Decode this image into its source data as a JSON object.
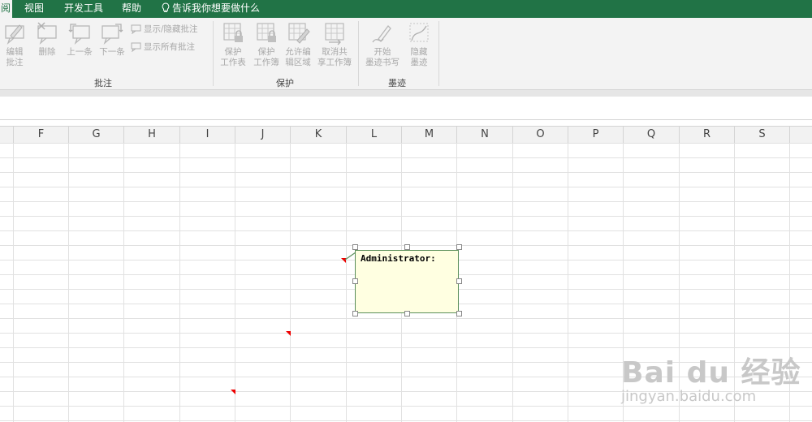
{
  "tabs": {
    "partial": "阅",
    "view": "视图",
    "developer": "开发工具",
    "help": "帮助",
    "tell_me": "告诉我你想要做什么"
  },
  "ribbon": {
    "comments_group": {
      "label": "批注",
      "edit": "编辑\n批注",
      "delete": "删除",
      "previous": "上一条",
      "next": "下一条",
      "show_hide": "显示/隐藏批注",
      "show_all": "显示所有批注"
    },
    "protect_group": {
      "label": "保护",
      "protect_sheet": "保护\n工作表",
      "protect_workbook": "保护\n工作簿",
      "allow_edit": "允许编\n辑区域",
      "unshare": "取消共\n享工作簿"
    },
    "ink_group": {
      "label": "墨迹",
      "start_ink": "开始\n墨迹书写",
      "hide_ink": "隐藏\n墨迹"
    }
  },
  "columns": [
    "F",
    "G",
    "H",
    "I",
    "J",
    "K",
    "L",
    "M",
    "N",
    "O",
    "P",
    "Q",
    "R",
    "S"
  ],
  "comment": {
    "author": "Administrator:"
  },
  "watermark": {
    "brand": "Bai du 经验",
    "url": "jingyan.baidu.com"
  },
  "colors": {
    "accent": "#217346",
    "comment_bg": "#ffffe1",
    "comment_marker": "#e00000"
  }
}
